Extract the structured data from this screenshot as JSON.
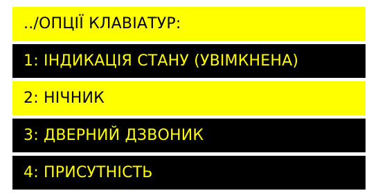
{
  "header": {
    "title": "../ОПЦІЇ КЛАВІАТУР:"
  },
  "menu": {
    "selected_index": 1,
    "items": [
      {
        "label": "1: ІНДИКАЦІЯ СТАНУ (УВІМКНЕНА)"
      },
      {
        "label": "2: НІЧНИК"
      },
      {
        "label": "3: ДВЕРНИЙ ДЗВОНИК"
      },
      {
        "label": "4: ПРИСУТНІСТЬ"
      }
    ]
  },
  "colors": {
    "highlight": "#ffff00",
    "background": "#000000",
    "page": "#ffffff"
  }
}
